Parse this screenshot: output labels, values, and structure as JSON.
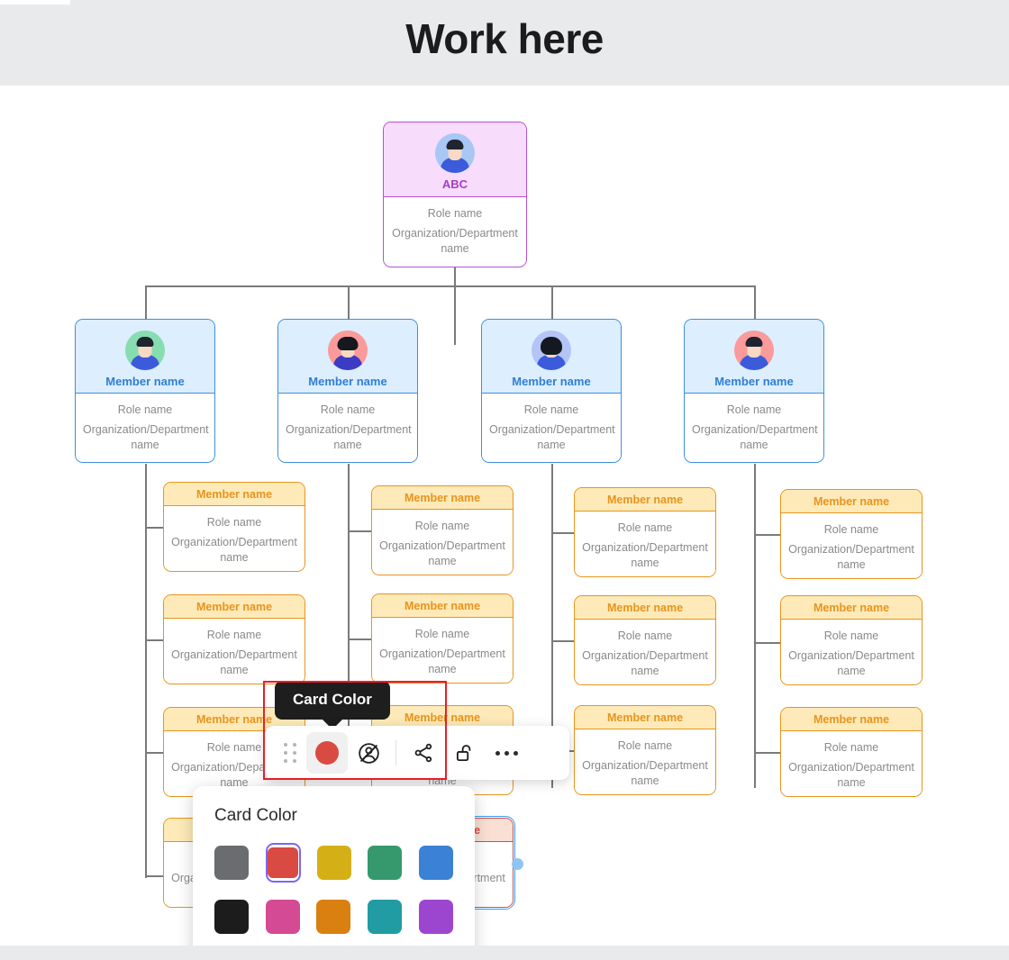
{
  "header": {
    "title": "Work here"
  },
  "chart": {
    "root": {
      "name": "ABC",
      "role": "Role name",
      "org_line1": "Organization/Department",
      "org_line2": "name",
      "avatar": "avatar-person-blue",
      "color": "#b84fd6"
    },
    "members": [
      {
        "name": "Member name",
        "role": "Role name",
        "org_line1": "Organization/Department",
        "org_line2": "name",
        "avatar": "avatar-person-green",
        "color": "#3d8ee0"
      },
      {
        "name": "Member name",
        "role": "Role name",
        "org_line1": "Organization/Department",
        "org_line2": "name",
        "avatar": "avatar-person-pink",
        "color": "#3d8ee0"
      },
      {
        "name": "Member name",
        "role": "Role name",
        "org_line1": "Organization/Department",
        "org_line2": "name",
        "avatar": "avatar-person-periwinkle",
        "color": "#3d8ee0"
      },
      {
        "name": "Member name",
        "role": "Role name",
        "org_line1": "Organization/Department",
        "org_line2": "name",
        "avatar": "avatar-person-salmon",
        "color": "#3d8ee0"
      }
    ],
    "reports": {
      "name": "Member name",
      "role": "Role name",
      "org_line1": "Organization/Department",
      "org_line2": "name"
    }
  },
  "tooltip": {
    "label": "Card Color"
  },
  "toolbar": {
    "drag_handle": "drag-handle",
    "card_color_label": "Card Color",
    "card_color_value": "#d94a42",
    "hide_avatar_label": "Hide avatar",
    "share_label": "Share",
    "lock_label": "Unlock",
    "more_label": "More options"
  },
  "color_picker": {
    "title": "Card Color",
    "selected": "#d94a42",
    "rows": [
      [
        {
          "name": "gray",
          "hex": "#6b6c70"
        },
        {
          "name": "red",
          "hex": "#d94a42"
        },
        {
          "name": "yellow",
          "hex": "#d4b016"
        },
        {
          "name": "green",
          "hex": "#36996e"
        },
        {
          "name": "blue",
          "hex": "#3b82d6"
        }
      ],
      [
        {
          "name": "black",
          "hex": "#1c1c1c"
        },
        {
          "name": "pink",
          "hex": "#d44a93"
        },
        {
          "name": "orange",
          "hex": "#da8010"
        },
        {
          "name": "teal",
          "hex": "#229ca3"
        },
        {
          "name": "purple",
          "hex": "#9c46cf"
        }
      ]
    ]
  }
}
